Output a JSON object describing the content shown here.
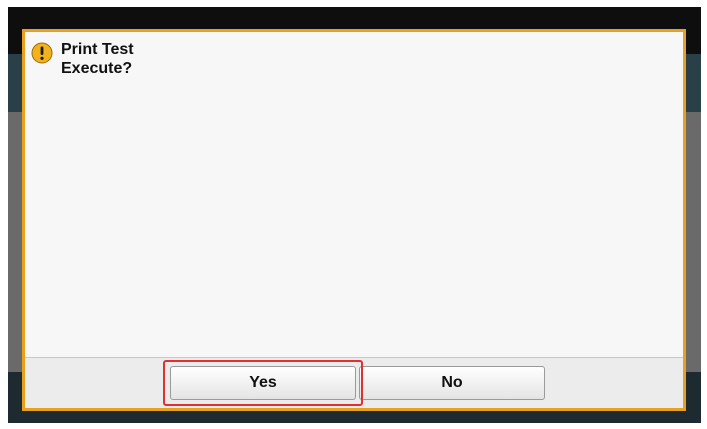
{
  "dialog": {
    "icon": "warning-icon",
    "title": "Print Test",
    "message": "Execute?",
    "accent_color": "#e8a020"
  },
  "buttons": {
    "yes_label": "Yes",
    "no_label": "No",
    "highlighted": "yes",
    "highlight_color": "#e03030"
  }
}
